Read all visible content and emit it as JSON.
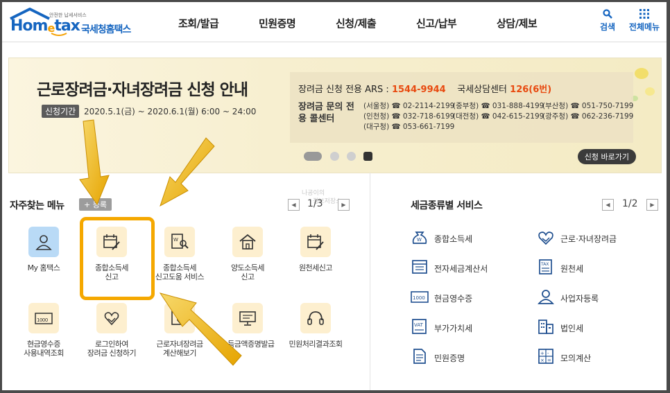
{
  "header": {
    "logo_sub": "안전한 납세서비스",
    "logo_brand_a": "Hom",
    "logo_brand_e": "e",
    "logo_brand_b": "tax",
    "logo_korean": "국세청홈택스",
    "nav": [
      "조회/발급",
      "민원증명",
      "신청/제출",
      "신고/납부",
      "상담/제보"
    ],
    "search_label": "검색",
    "menu_label": "전체메뉴"
  },
  "banner": {
    "title": "근로장려금·자녀장려금 신청 안내",
    "period_tag": "신청기간",
    "period_text": "2020.5.1(금) ~ 2020.6.1(월) 6:00 ~ 24:00",
    "ars_label": "장려금 신청 전용 ARS : ",
    "ars_number": "1544-9944",
    "center_label": "국세상담센터 ",
    "center_number": "126(6번)",
    "contact_title": "장려금 문의 전용 콜센터",
    "contacts": [
      [
        "(서울청) ☎ 02-2114-2199",
        "(중부청) ☎ 031-888-4199",
        "(부산청) ☎ 051-750-7199"
      ],
      [
        "(인천청) ☎ 032-718-6199",
        "(대전청) ☎ 042-615-2199",
        "(광주청) ☎ 062-236-7199"
      ],
      [
        "(대구청) ☎ 053-661-7199"
      ]
    ],
    "apply_button": "신청 바로가기"
  },
  "favorites": {
    "title": "자주찾는 메뉴",
    "register_button": "+ 등록",
    "page": "1/3",
    "watermark_line1": "나공이의",
    "watermark_line2": "정보저장소",
    "items": [
      {
        "line1": "My 홈택스",
        "line2": "",
        "icon": "person-icon"
      },
      {
        "line1": "종합소득세",
        "line2": "신고",
        "icon": "calendar-pen-icon"
      },
      {
        "line1": "종합소득세",
        "line2": "신고도움 서비스",
        "icon": "document-search-icon"
      },
      {
        "line1": "양도소득세",
        "line2": "신고",
        "icon": "house-icon"
      },
      {
        "line1": "원천세신고",
        "line2": "",
        "icon": "calendar-pen-icon"
      },
      {
        "line1": "현금영수증",
        "line2": "사용내역조회",
        "icon": "receipt-1000-icon"
      },
      {
        "line1": "로그인하여",
        "line2": "장려금 신청하기",
        "icon": "heart-hand-icon"
      },
      {
        "line1": "근로자녀장려금",
        "line2": "계산해보기",
        "icon": "heart-calc-icon"
      },
      {
        "line1": "소득금액증명발급",
        "line2": "",
        "icon": "monitor-doc-icon"
      },
      {
        "line1": "민원처리결과조회",
        "line2": "",
        "icon": "headset-icon"
      }
    ]
  },
  "tax_services": {
    "title": "세금종류별 서비스",
    "page": "1/2",
    "items": [
      {
        "label": "종합소득세",
        "icon": "money-bag-icon"
      },
      {
        "label": "근로·자녀장려금",
        "icon": "heart-hand-icon"
      },
      {
        "label": "전자세금계산서",
        "icon": "invoice-icon"
      },
      {
        "label": "원천세",
        "icon": "tax-doc-icon"
      },
      {
        "label": "현금영수증",
        "icon": "receipt-1000-icon"
      },
      {
        "label": "사업자등록",
        "icon": "person-icon"
      },
      {
        "label": "부가가치세",
        "icon": "vat-icon"
      },
      {
        "label": "법인세",
        "icon": "building-icon"
      },
      {
        "label": "민원증명",
        "icon": "document-icon"
      },
      {
        "label": "모의계산",
        "icon": "calculator-icon"
      }
    ]
  },
  "colors": {
    "brand_blue": "#1565c0",
    "accent_orange": "#e8490f",
    "highlight": "#f5a800"
  }
}
